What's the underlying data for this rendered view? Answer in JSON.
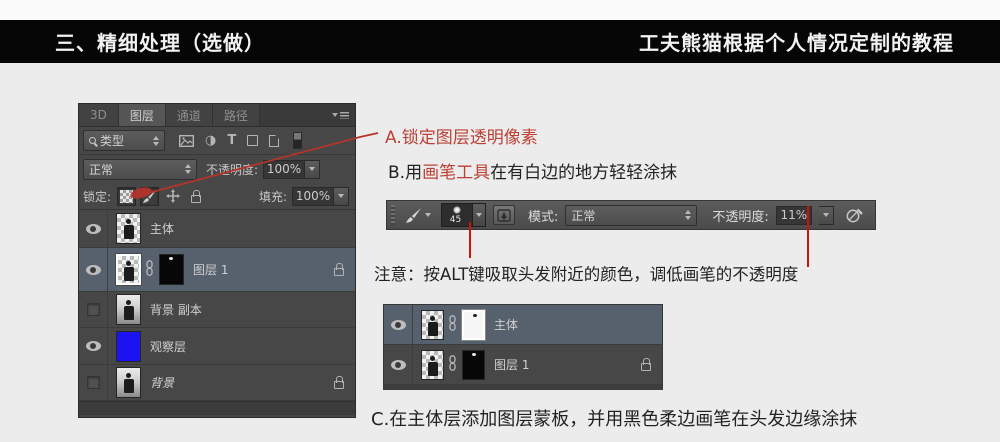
{
  "header": {
    "left_title": "三、精细处理（选做）",
    "right_title": "工夫熊猫根据个人情况定制的教程"
  },
  "layers_panel": {
    "tabs": {
      "t3d": "3D",
      "layers": "图层",
      "channels": "通道",
      "paths": "路径"
    },
    "filter_label": "类型",
    "blend_mode": "正常",
    "opacity_label": "不透明度:",
    "opacity_value": "100%",
    "lock_label": "锁定:",
    "fill_label": "填充:",
    "fill_value": "100%",
    "layers": [
      {
        "name": "主体",
        "visible": true,
        "locked": false
      },
      {
        "name": "图层 1",
        "visible": true,
        "locked": true,
        "selected": true
      },
      {
        "name": "背景 副本",
        "visible": false,
        "locked": false
      },
      {
        "name": "观察层",
        "visible": true,
        "locked": false
      },
      {
        "name": "背景",
        "visible": false,
        "locked": true
      }
    ]
  },
  "brush_toolbar": {
    "brush_size": "45",
    "mode_label": "模式:",
    "mode_value": "正常",
    "opacity_label": "不透明度:",
    "opacity_value": "11%"
  },
  "mask_panel": {
    "layers": [
      {
        "name": "主体",
        "selected": true
      },
      {
        "name": "图层 1",
        "locked": true
      }
    ]
  },
  "annotations": {
    "a_label": "A.锁定图层透明像素",
    "b_prefix": "B.用",
    "b_highlight": "画笔工具",
    "b_suffix": "在有白边的地方轻轻涂抹",
    "note": "注意：按ALT键吸取头发附近的颜色，调低画笔的不透明度",
    "c_label": "C.在主体层添加图层蒙板，并用黑色柔边画笔在头发边缘涂抹"
  },
  "colors": {
    "annotation_red": "#bb4036",
    "pointer_red": "#c81708",
    "panel_bg": "#474747",
    "selected_row": "#57616d",
    "observe_layer_blue": "#1c13f2"
  }
}
